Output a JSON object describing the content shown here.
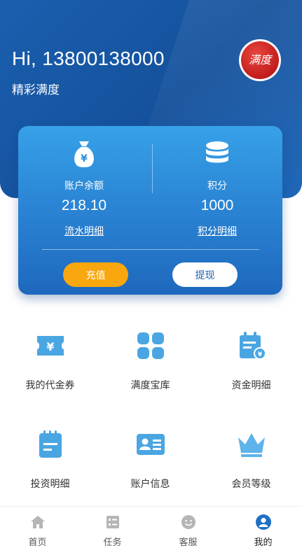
{
  "header": {
    "greeting": "Hi, 13800138000",
    "subtitle": "精彩满度",
    "avatar_text": "满度"
  },
  "account": {
    "balance_label": "账户余额",
    "balance_value": "218.10",
    "balance_link": "流水明细",
    "points_label": "积分",
    "points_value": "1000",
    "points_link": "积分明细",
    "recharge_label": "充值",
    "withdraw_label": "提现"
  },
  "colors": {
    "header_blue": "#15519c",
    "card_blue": "#2b86d5",
    "recharge_orange": "#f9a70f",
    "icon_blue": "#4aa6e2",
    "member_blue": "#5db3ea"
  },
  "menu": [
    {
      "label": "我的代金券",
      "icon": "voucher-icon"
    },
    {
      "label": "满度宝库",
      "icon": "grid-icon"
    },
    {
      "label": "资金明细",
      "icon": "calendar-money-icon"
    },
    {
      "label": "投资明细",
      "icon": "notepad-icon"
    },
    {
      "label": "账户信息",
      "icon": "id-card-icon"
    },
    {
      "label": "会员等级",
      "icon": "crown-icon"
    }
  ],
  "tabbar": [
    {
      "label": "首页",
      "icon": "home-icon"
    },
    {
      "label": "任务",
      "icon": "task-icon"
    },
    {
      "label": "客服",
      "icon": "service-icon"
    },
    {
      "label": "我的",
      "icon": "user-icon"
    }
  ],
  "tabbar_active_index": 3
}
